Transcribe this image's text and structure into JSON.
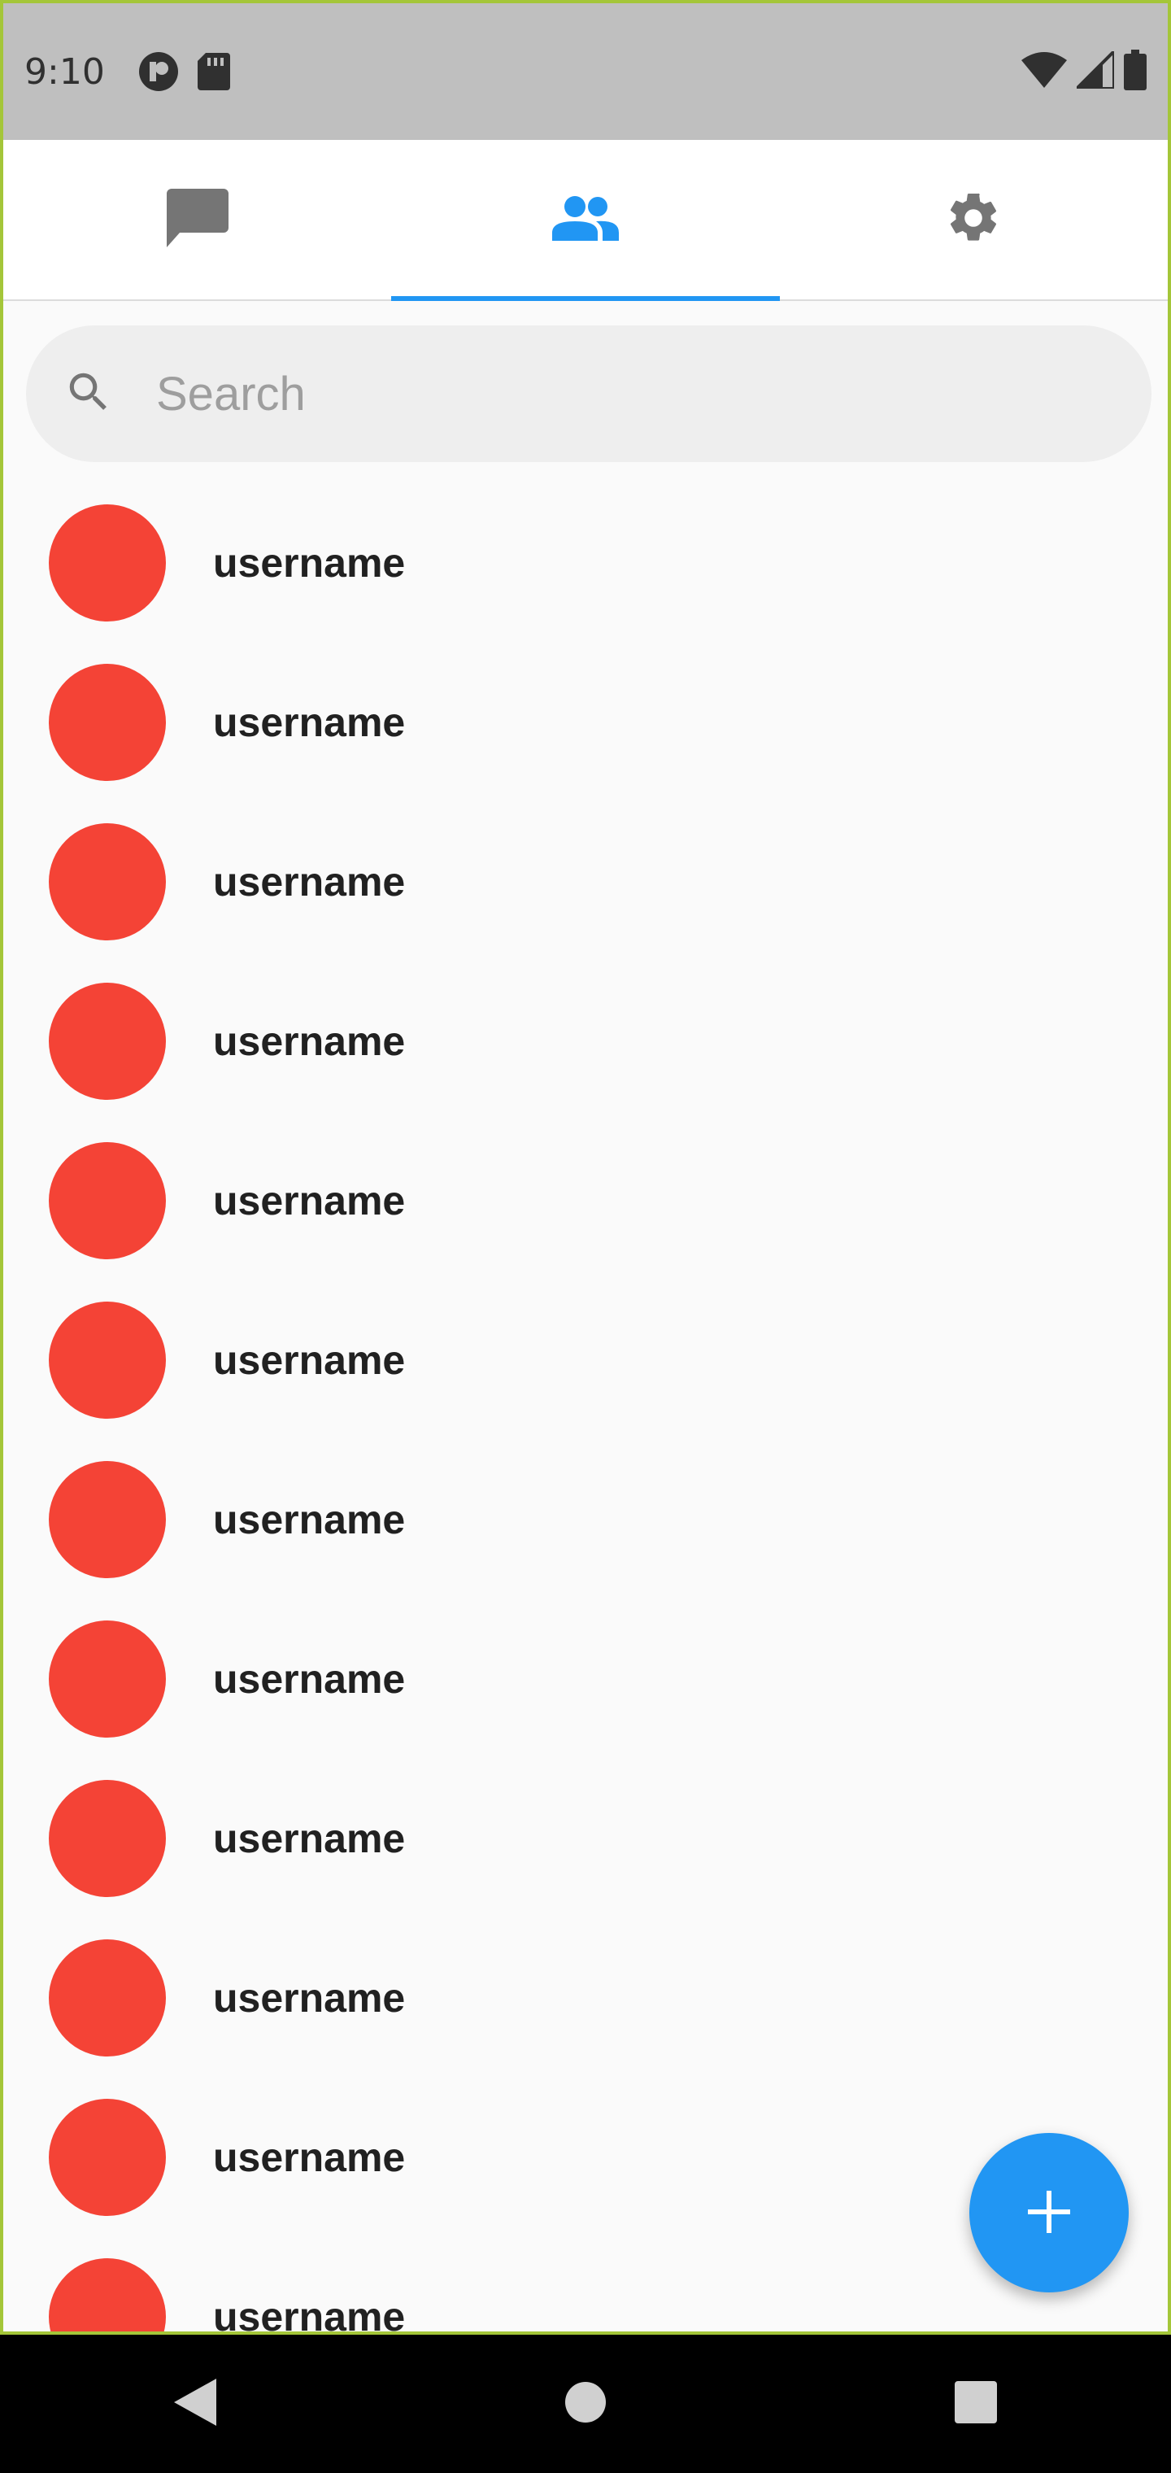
{
  "status_bar": {
    "time": "9:10",
    "icons_left": [
      "notification-app-icon",
      "sd-card-icon"
    ],
    "icons_right": [
      "wifi-icon",
      "signal-icon",
      "battery-icon"
    ]
  },
  "tabs": [
    {
      "icon": "chat-icon",
      "active": false
    },
    {
      "icon": "people-icon",
      "active": true
    },
    {
      "icon": "settings-gear-icon",
      "active": false
    }
  ],
  "search": {
    "placeholder": "Search",
    "value": ""
  },
  "users": [
    {
      "name": "username"
    },
    {
      "name": "username"
    },
    {
      "name": "username"
    },
    {
      "name": "username"
    },
    {
      "name": "username"
    },
    {
      "name": "username"
    },
    {
      "name": "username"
    },
    {
      "name": "username"
    },
    {
      "name": "username"
    },
    {
      "name": "username"
    },
    {
      "name": "username"
    },
    {
      "name": "username"
    }
  ],
  "fab": {
    "icon": "plus-icon"
  },
  "nav": {
    "icons": [
      "back-icon",
      "home-icon",
      "recents-icon"
    ]
  },
  "colors": {
    "accent": "#2196f3",
    "avatar": "#f44336",
    "status_bar": "#bfbfbf",
    "frame_border": "#a4c639"
  }
}
